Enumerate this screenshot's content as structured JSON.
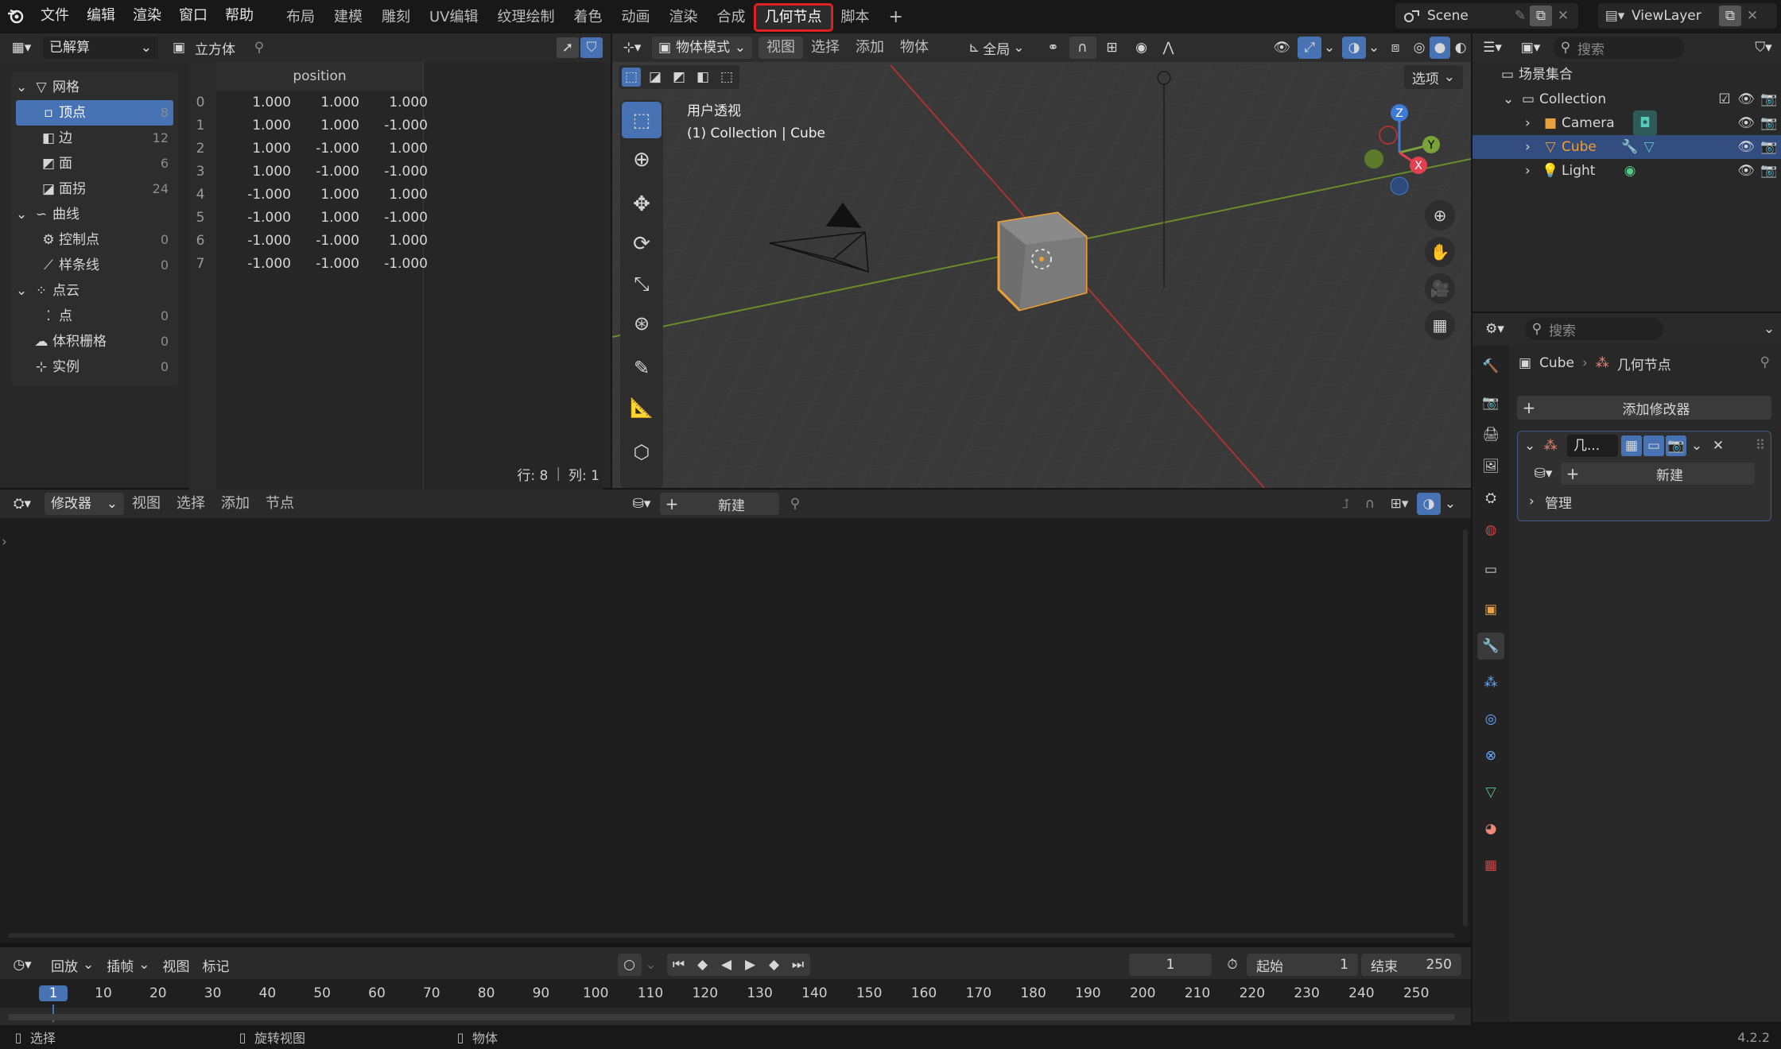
{
  "topbar": {
    "menus": [
      "文件",
      "编辑",
      "渲染",
      "窗口",
      "帮助"
    ],
    "workspaces": [
      "布局",
      "建模",
      "雕刻",
      "UV编辑",
      "纹理绘制",
      "着色",
      "动画",
      "渲染",
      "合成",
      "几何节点",
      "脚本"
    ],
    "active_workspace": "几何节点",
    "add_tab": "+",
    "scene": "Scene",
    "view_layer": "ViewLayer"
  },
  "spreadsheet": {
    "mode": "已解算",
    "object": "立方体",
    "tree": [
      {
        "label": "网格",
        "count": "",
        "level": 0,
        "icon": "mesh-icon"
      },
      {
        "label": "顶点",
        "count": "8",
        "level": 1,
        "icon": "vertex-icon",
        "selected": true
      },
      {
        "label": "边",
        "count": "12",
        "level": 1,
        "icon": "edge-icon"
      },
      {
        "label": "面",
        "count": "6",
        "level": 1,
        "icon": "face-icon"
      },
      {
        "label": "面拐",
        "count": "24",
        "level": 1,
        "icon": "face-corner-icon"
      },
      {
        "label": "曲线",
        "count": "",
        "level": 0,
        "icon": "curve-icon"
      },
      {
        "label": "控制点",
        "count": "0",
        "level": 1,
        "icon": "control-point-icon"
      },
      {
        "label": "样条线",
        "count": "0",
        "level": 1,
        "icon": "spline-icon"
      },
      {
        "label": "点云",
        "count": "",
        "level": 0,
        "icon": "pointcloud-icon"
      },
      {
        "label": "点",
        "count": "0",
        "level": 1,
        "icon": "point-icon"
      },
      {
        "label": "体积栅格",
        "count": "0",
        "level": 0,
        "icon": "volume-icon"
      },
      {
        "label": "实例",
        "count": "0",
        "level": 0,
        "icon": "instance-icon"
      }
    ],
    "column_header": "position",
    "rows": [
      [
        "0",
        "1.000",
        "1.000",
        "1.000"
      ],
      [
        "1",
        "1.000",
        "1.000",
        "-1.000"
      ],
      [
        "2",
        "1.000",
        "-1.000",
        "1.000"
      ],
      [
        "3",
        "1.000",
        "-1.000",
        "-1.000"
      ],
      [
        "4",
        "-1.000",
        "1.000",
        "1.000"
      ],
      [
        "5",
        "-1.000",
        "1.000",
        "-1.000"
      ],
      [
        "6",
        "-1.000",
        "-1.000",
        "1.000"
      ],
      [
        "7",
        "-1.000",
        "-1.000",
        "-1.000"
      ]
    ],
    "status_rows": "行: 8",
    "status_sep": "|",
    "status_cols": "列: 1"
  },
  "viewport": {
    "mode": "物体模式",
    "menus": [
      "视图",
      "选择",
      "添加",
      "物体"
    ],
    "transform_orient": "全局",
    "options": "选项",
    "overlay_title": "用户透视",
    "overlay_sub": "(1) Collection | Cube",
    "gizmo": {
      "x": "X",
      "y": "Y",
      "z": "Z"
    }
  },
  "node_editor": {
    "type": "修改器",
    "menus": [
      "视图",
      "选择",
      "添加",
      "节点"
    ],
    "new_label": "新建"
  },
  "outliner": {
    "search_placeholder": "搜索",
    "scene_collection": "场景集合",
    "collection": "Collection",
    "items": [
      {
        "label": "Camera",
        "icon": "camera-icon"
      },
      {
        "label": "Cube",
        "icon": "mesh-object-icon",
        "selected": true
      },
      {
        "label": "Light",
        "icon": "light-icon"
      }
    ]
  },
  "properties": {
    "search_placeholder": "搜索",
    "breadcrumb_object": "Cube",
    "breadcrumb_sep": "›",
    "breadcrumb_modifier": "几何节点",
    "add_modifier": "添加修改器",
    "modifier_name": "几...",
    "new_label": "新建",
    "manage": "管理"
  },
  "timeline": {
    "menus": [
      "回放",
      "插帧",
      "视图",
      "标记"
    ],
    "current_frame": "1",
    "start_label": "起始",
    "start": "1",
    "end_label": "结束",
    "end": "250",
    "ticks": [
      "1",
      "10",
      "20",
      "30",
      "40",
      "50",
      "60",
      "70",
      "80",
      "90",
      "100",
      "110",
      "120",
      "130",
      "140",
      "150",
      "160",
      "170",
      "180",
      "190",
      "200",
      "210",
      "220",
      "230",
      "240",
      "250"
    ]
  },
  "statusbar": {
    "select": "选择",
    "rotate": "旋转视图",
    "object": "物体",
    "version": "4.2.2"
  },
  "colors": {
    "accent": "#4772b3",
    "active_outline": "#e02020",
    "selected_orange": "#f0a030"
  }
}
